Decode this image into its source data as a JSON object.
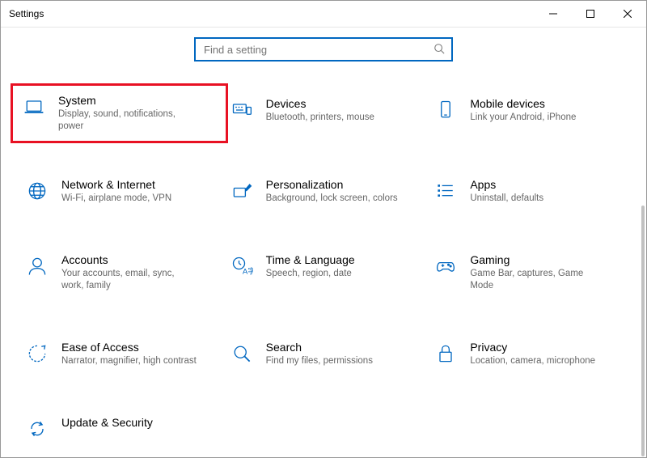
{
  "window": {
    "title": "Settings"
  },
  "search": {
    "placeholder": "Find a setting"
  },
  "tiles": {
    "system": {
      "name": "System",
      "desc": "Display, sound, notifications, power"
    },
    "devices": {
      "name": "Devices",
      "desc": "Bluetooth, printers, mouse"
    },
    "mobile": {
      "name": "Mobile devices",
      "desc": "Link your Android, iPhone"
    },
    "network": {
      "name": "Network & Internet",
      "desc": "Wi-Fi, airplane mode, VPN"
    },
    "personalize": {
      "name": "Personalization",
      "desc": "Background, lock screen, colors"
    },
    "apps": {
      "name": "Apps",
      "desc": "Uninstall, defaults"
    },
    "accounts": {
      "name": "Accounts",
      "desc": "Your accounts, email, sync, work, family"
    },
    "time": {
      "name": "Time & Language",
      "desc": "Speech, region, date"
    },
    "gaming": {
      "name": "Gaming",
      "desc": "Game Bar, captures, Game Mode"
    },
    "ease": {
      "name": "Ease of Access",
      "desc": "Narrator, magnifier, high contrast"
    },
    "searchcat": {
      "name": "Search",
      "desc": "Find my files, permissions"
    },
    "privacy": {
      "name": "Privacy",
      "desc": "Location, camera, microphone"
    },
    "update": {
      "name": "Update & Security",
      "desc": ""
    }
  }
}
